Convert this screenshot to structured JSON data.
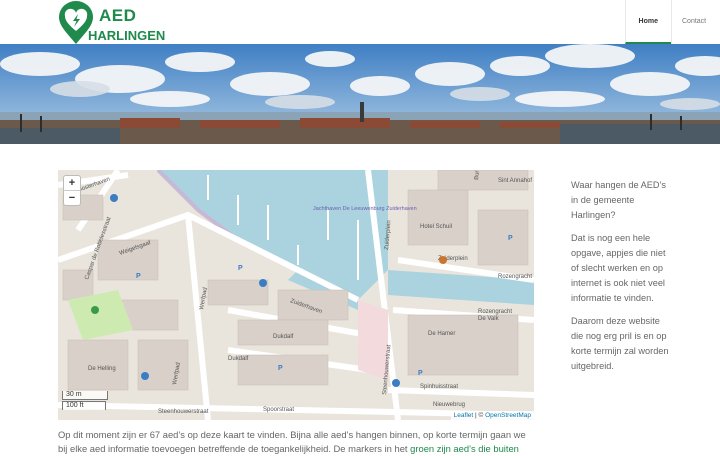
{
  "header": {
    "logo_title": "AED",
    "logo_subtitle": "HARLINGEN",
    "nav": [
      {
        "label": "Home",
        "active": true
      },
      {
        "label": "Contact",
        "active": false
      }
    ]
  },
  "colors": {
    "brand": "#1f8a4c",
    "water": "#aad3df",
    "land": "#e9e5dc"
  },
  "map": {
    "zoom_in": "+",
    "zoom_out": "−",
    "scale_m": "30 m",
    "scale_ft": "100 ft",
    "attribution_leaflet": "Leaflet",
    "attribution_sep": " | © ",
    "attribution_osm": "OpenStreetMap",
    "labels": {
      "oosterhaven": "Oosterhaven",
      "caspar": "Caspar de Robelesstraat",
      "weigelsgaaf": "Weigelsgaaf",
      "werfpad": "Werfpad",
      "zuiderhaven": "Zuiderhaven",
      "dukdalf": "Dukdalf",
      "dukdalf2": "Dukdalf",
      "dehelling": "De Helling",
      "werfpad2": "Werfpad",
      "steenhouwerstraat": "Steenhouwerstraat",
      "steenhouwerstraat2": "Steenhouwerstraat",
      "spoorstraat": "Spoorstraat",
      "zuiderplein": "Zuiderplein",
      "zuiderpleinv": "Zuiderplein",
      "rozengracht": "Rozengracht",
      "rozengracht2": "Rozengracht",
      "spinhuisstraat": "Spinhuisstraat",
      "nieuwebrug": "Nieuwebrug",
      "stannahof": "Sint Annahof",
      "jachthaven": "Jachthaven De Leeuwenburg Zuiderhaven",
      "hotel": "Hotel Schuil",
      "dehamer": "De Hamer",
      "devalk": "De Valk",
      "bur": "Bur"
    }
  },
  "sidebar": {
    "p1": "Waar hangen de AED’s in de gemeente Harlingen?",
    "p2": "Dat is nog een hele opgave, appjes die niet of slecht werken en op internet is ook niet veel informatie te vinden.",
    "p3": "Daarom deze website die nog erg pril is en op korte termijn zal worden uitgebreid."
  },
  "body": {
    "line1": "Op dit moment zijn er 67 aed’s op deze kaart te vinden. Bijna alle aed’s hangen binnen, op korte termijn gaan we",
    "line2_a": "bij elke aed informatie toevoegen betreffende de toegankelijkheid. De markers in het ",
    "line2_link": "groen zijn aed’s die buiten"
  }
}
